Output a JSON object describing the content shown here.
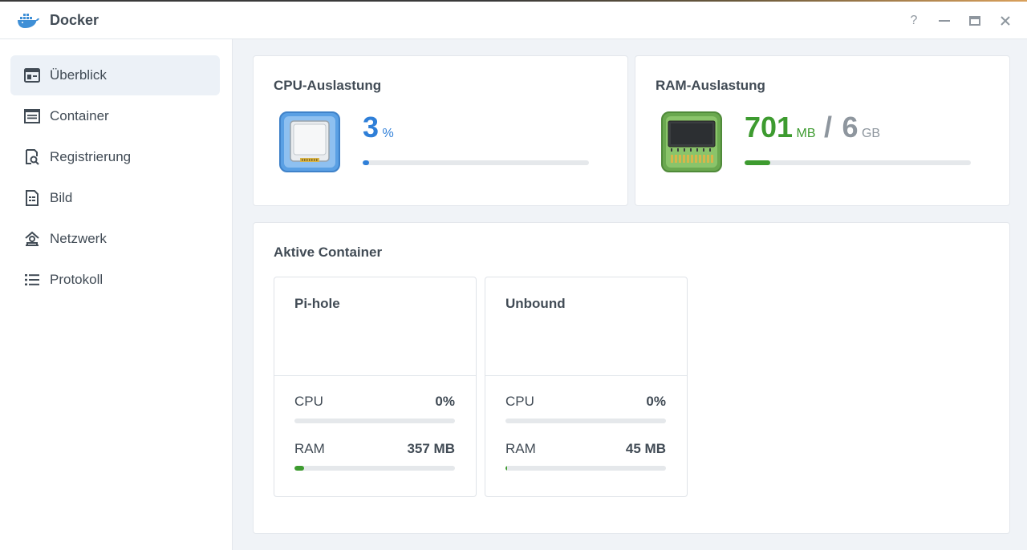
{
  "window": {
    "title": "Docker",
    "controls": {
      "help": "?",
      "minimize": "—",
      "maximize": "▭",
      "close": "✕"
    }
  },
  "sidebar": {
    "items": [
      {
        "label": "Überblick",
        "icon": "overview-icon",
        "active": true
      },
      {
        "label": "Container",
        "icon": "container-icon",
        "active": false
      },
      {
        "label": "Registrierung",
        "icon": "registry-icon",
        "active": false
      },
      {
        "label": "Bild",
        "icon": "image-icon",
        "active": false
      },
      {
        "label": "Netzwerk",
        "icon": "network-icon",
        "active": false
      },
      {
        "label": "Protokoll",
        "icon": "log-icon",
        "active": false
      }
    ]
  },
  "cpu": {
    "title": "CPU-Auslastung",
    "value": "3",
    "unit": "%",
    "percent": 3,
    "color": "#2f7fd8"
  },
  "ram": {
    "title": "RAM-Auslastung",
    "used": "701",
    "used_unit": "MB",
    "separator": "/",
    "total": "6",
    "total_unit": "GB",
    "percent": 11.4,
    "color": "#3d9b2f"
  },
  "containers": {
    "title": "Aktive Container",
    "items": [
      {
        "name": "Pi-hole",
        "cpu_label": "CPU",
        "cpu_value": "0%",
        "cpu_percent": 0,
        "ram_label": "RAM",
        "ram_value": "357 MB",
        "ram_percent": 5.8
      },
      {
        "name": "Unbound",
        "cpu_label": "CPU",
        "cpu_value": "0%",
        "cpu_percent": 0,
        "ram_label": "RAM",
        "ram_value": "45 MB",
        "ram_percent": 0.8
      }
    ]
  }
}
